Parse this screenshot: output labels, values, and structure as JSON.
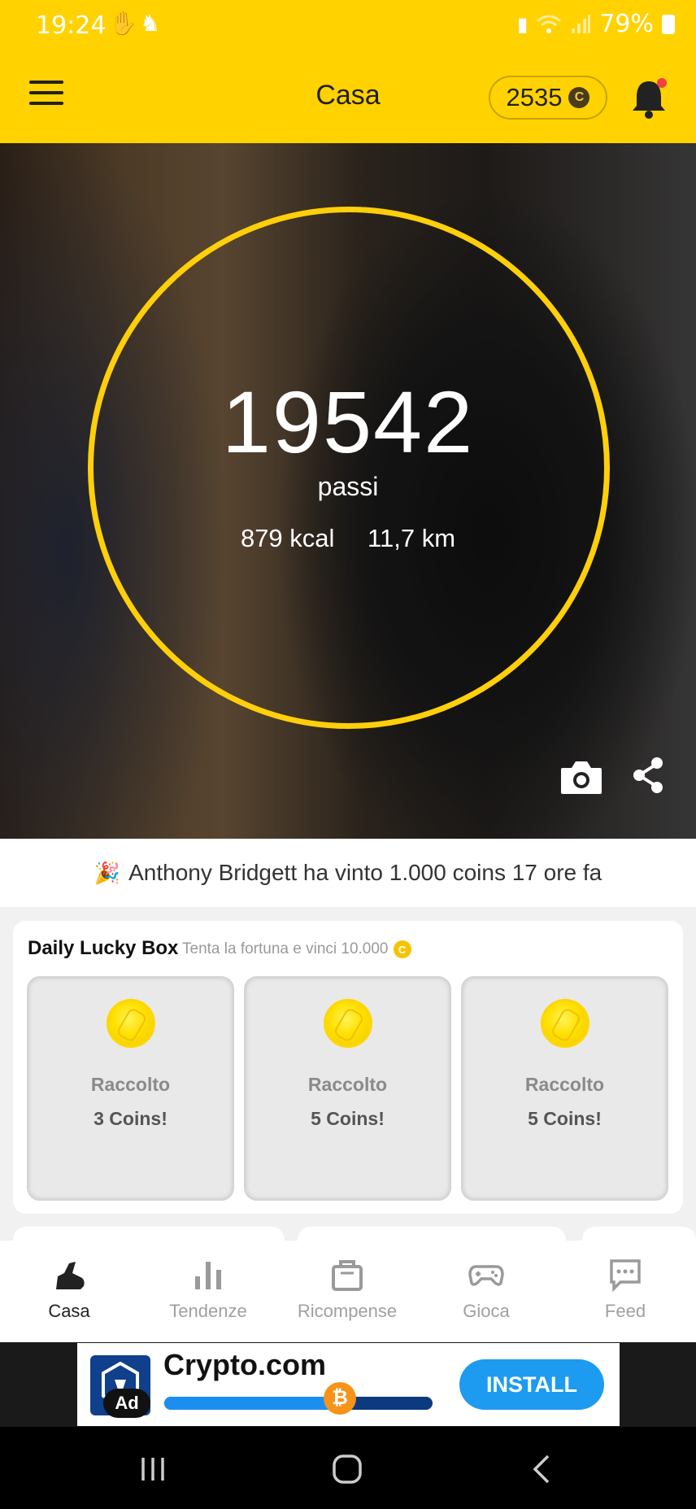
{
  "status_bar": {
    "time": "19:24",
    "battery": "79%"
  },
  "header": {
    "title": "Casa",
    "coins": "2535",
    "coin_symbol": "C"
  },
  "tracker": {
    "steps": "19542",
    "steps_label": "passi",
    "kcal": "879 kcal",
    "distance": "11,7 km"
  },
  "winner_message": "Anthony Bridgett ha vinto 1.000 coins 17 ore fa",
  "lucky_box": {
    "title": "Daily Lucky Box",
    "subtitle": "Tenta la fortuna e vinci 10.000",
    "coin_symbol": "C",
    "boxes": [
      {
        "label": "Raccolto",
        "prize": "3 Coins!"
      },
      {
        "label": "Raccolto",
        "prize": "5 Coins!"
      },
      {
        "label": "Raccolto",
        "prize": "5 Coins!"
      }
    ]
  },
  "bottom_nav": {
    "items": [
      {
        "label": "Casa",
        "icon": "shoe-icon",
        "active": true
      },
      {
        "label": "Tendenze",
        "icon": "bar-chart-icon",
        "active": false
      },
      {
        "label": "Ricompense",
        "icon": "shopping-bag-icon",
        "active": false
      },
      {
        "label": "Gioca",
        "icon": "gamepad-icon",
        "active": false
      },
      {
        "label": "Feed",
        "icon": "chat-bubble-icon",
        "active": false
      }
    ]
  },
  "ad": {
    "title": "Crypto.com",
    "badge": "Ad",
    "cta": "INSTALL",
    "progress": 0.7,
    "progress_color": "#1b8ff0"
  },
  "colors": {
    "brand_yellow": "#ffd200",
    "ring": "#ffcf0a",
    "install_blue": "#1d9bf0"
  }
}
